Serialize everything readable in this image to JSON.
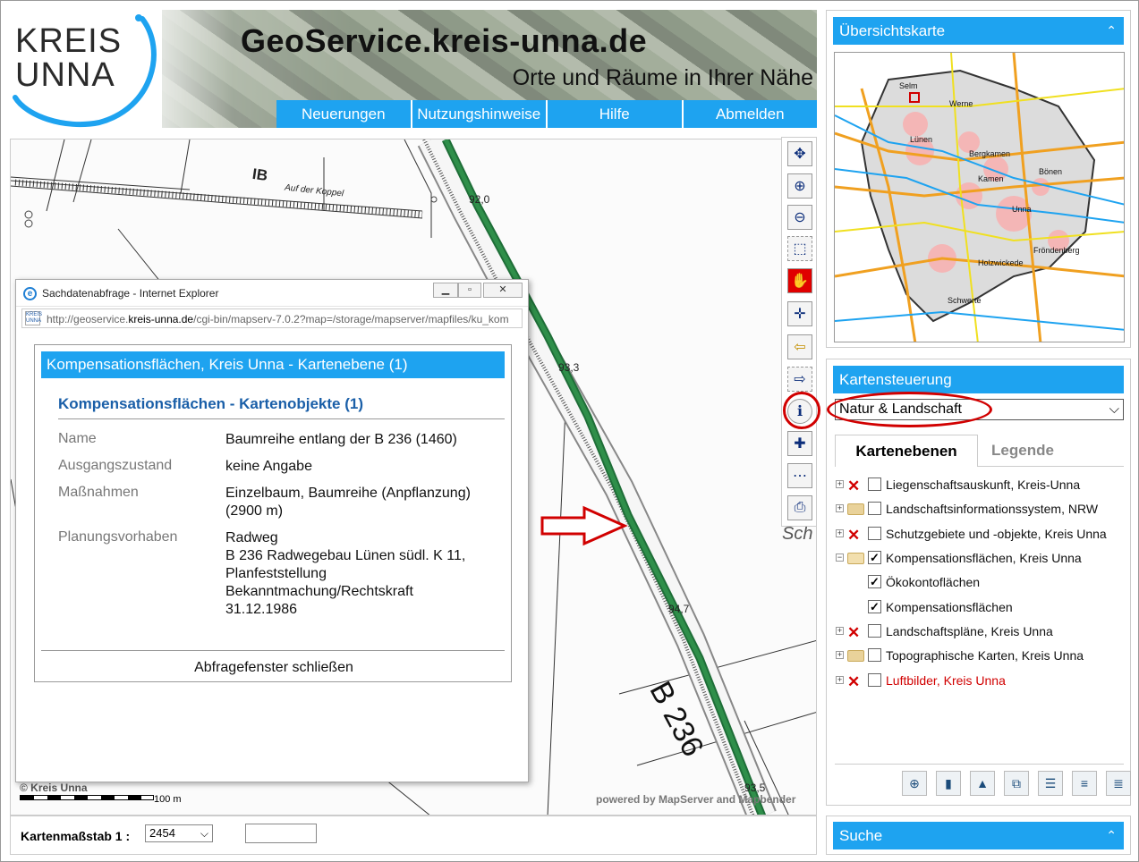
{
  "header": {
    "logo_line1": "KREIS",
    "logo_line2": "UNNA",
    "title": "GeoService.kreis-unna.de",
    "subtitle": "Orte und Räume in Ihrer Nähe",
    "nav": [
      "Neuerungen",
      "Nutzungshinweise",
      "Hilfe",
      "Abmelden"
    ],
    "colors": {
      "nav_bg": "#1ea3f0",
      "accent_red": "#d10000"
    }
  },
  "map": {
    "labels": {
      "ib": "IB",
      "street": "Auf der Koppel",
      "height1": "92,0",
      "height2": "93,3",
      "height3": "94,7",
      "height4": "93,5",
      "road": "B 236",
      "sch": "Sch"
    },
    "copyright": "© Kreis Unna",
    "scale_label": "100 m",
    "powered": "powered by MapServer and Mapbender"
  },
  "toolbar": {
    "tools": [
      {
        "name": "overview-tool-icon",
        "glyph": "✥"
      },
      {
        "name": "zoom-in-icon",
        "glyph": "⊕"
      },
      {
        "name": "zoom-out-icon",
        "glyph": "⊖"
      },
      {
        "name": "zoom-box-icon",
        "glyph": "⬚"
      },
      {
        "name": "pan-hand-icon",
        "glyph": "✋"
      },
      {
        "name": "full-extent-icon",
        "glyph": "✛"
      },
      {
        "name": "back-arrow-icon",
        "glyph": "⇦"
      },
      {
        "name": "forward-arrow-icon",
        "glyph": "⇨"
      },
      {
        "name": "info-icon",
        "glyph": "ℹ"
      },
      {
        "name": "crosshair-icon",
        "glyph": "✚"
      },
      {
        "name": "measure-icon",
        "glyph": "⋯"
      },
      {
        "name": "print-icon",
        "glyph": "⎙"
      }
    ]
  },
  "bottombar": {
    "scale_text": "Kartenmaßstab 1 :",
    "scale_value": "2454"
  },
  "popup": {
    "window_title": "Sachdatenabfrage - Internet Explorer",
    "url_prefix": "http://geoservice.",
    "url_host": "kreis-unna.de",
    "url_rest": "/cgi-bin/mapserv-7.0.2?map=/storage/mapserver/mapfiles/ku_kom",
    "layer_heading": "Kompensationsflächen, Kreis Unna - Kartenebene (1)",
    "objects_heading": "Kompensationsflächen - Kartenobjekte (1)",
    "attributes": [
      {
        "label": "Name",
        "value": "Baumreihe entlang der B 236 (1460)"
      },
      {
        "label": "Ausgangszustand",
        "value": "keine Angabe"
      },
      {
        "label": "Maßnahmen",
        "value_lines": [
          "Einzelbaum, Baumreihe (Anpflanzung)",
          "(2900 m)"
        ]
      },
      {
        "label": "Planungsvorhaben",
        "value_lines": [
          "Radweg",
          "B 236 Radwegebau Lünen südl. K 11,",
          "Planfeststellung",
          "Bekanntmachung/Rechtskraft",
          "31.12.1986"
        ]
      }
    ],
    "close_label": "Abfragefenster schließen"
  },
  "overview": {
    "title": "Übersichtskarte",
    "places": [
      "Selm",
      "Werne",
      "Lünen",
      "Bergkamen",
      "Kamen",
      "Bönen",
      "Unna",
      "Fröndenberg",
      "Holzwickede",
      "Schwerte"
    ]
  },
  "control": {
    "title": "Kartensteuerung",
    "theme": "Natur & Landschaft",
    "tabs": [
      "Kartenebenen",
      "Legende"
    ],
    "layers": [
      {
        "label": "Liegenschaftsauskunft, Kreis-Unna",
        "icon": "x",
        "checked": false
      },
      {
        "label": "Landschaftsinformationssystem, NRW",
        "icon": "folder",
        "checked": false
      },
      {
        "label": "Schutzgebiete und -objekte, Kreis Unna",
        "icon": "x",
        "checked": false
      },
      {
        "label": "Kompensationsflächen, Kreis Unna",
        "icon": "folder-open",
        "checked": true
      },
      {
        "label": "Ökokontoflächen",
        "icon": "none",
        "checked": true,
        "child": true
      },
      {
        "label": "Kompensationsflächen",
        "icon": "none",
        "checked": true,
        "child": true
      },
      {
        "label": "Landschaftspläne, Kreis Unna",
        "icon": "x",
        "checked": false
      },
      {
        "label": "Topographische Karten, Kreis Unna",
        "icon": "folder",
        "checked": false
      },
      {
        "label": "Luftbilder, Kreis Unna",
        "icon": "x",
        "checked": false,
        "red": true
      }
    ]
  },
  "search": {
    "title": "Suche"
  }
}
